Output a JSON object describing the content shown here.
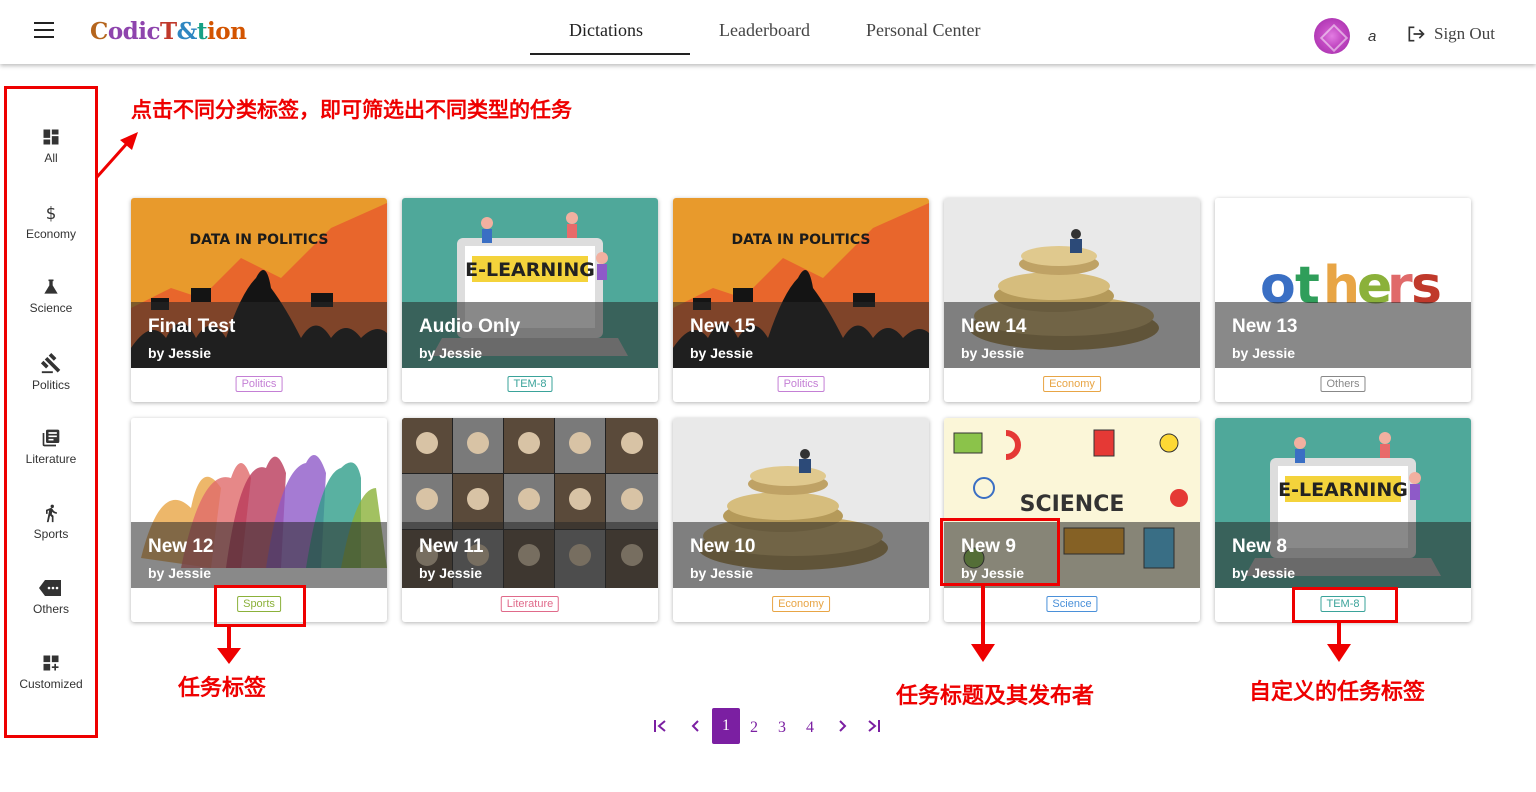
{
  "header": {
    "logo": {
      "c1": "C",
      "c2": "odic",
      "c3": "T",
      "c4": "&",
      "c5": "t",
      "c6": "ion"
    },
    "nav": [
      "Dictations",
      "Leaderboard",
      "Personal Center"
    ],
    "active_nav": "Dictations",
    "username": "a",
    "sign_out": "Sign Out"
  },
  "sidebar": {
    "items": [
      {
        "label": "All",
        "icon": "dashboard-icon"
      },
      {
        "label": "Economy",
        "icon": "dollar-icon"
      },
      {
        "label": "Science",
        "icon": "flask-icon"
      },
      {
        "label": "Politics",
        "icon": "gavel-icon"
      },
      {
        "label": "Literature",
        "icon": "library-books-icon"
      },
      {
        "label": "Sports",
        "icon": "run-icon"
      },
      {
        "label": "Others",
        "icon": "label-icon"
      },
      {
        "label": "Customized",
        "icon": "dashboard-add-icon"
      }
    ]
  },
  "annotations": {
    "filter_hint": "点击不同分类标签，即可筛选出不同类型的任务",
    "task_tag": "任务标签",
    "title_publisher": "任务标题及其发布者",
    "custom_tag": "自定义的任务标签"
  },
  "cards": [
    {
      "title": "Final Test",
      "author": "by Jessie",
      "tag": "Politics",
      "tag_color": "#c47fd5",
      "image": "data-in-politics",
      "image_text": "DATA IN POLITICS"
    },
    {
      "title": "Audio Only",
      "author": "by Jessie",
      "tag": "TEM-8",
      "tag_color": "#3aa39a",
      "image": "e-learning",
      "image_text": "E-LEARNING"
    },
    {
      "title": "New 15",
      "author": "by Jessie",
      "tag": "Politics",
      "tag_color": "#c47fd5",
      "image": "data-in-politics",
      "image_text": "DATA IN POLITICS"
    },
    {
      "title": "New 14",
      "author": "by Jessie",
      "tag": "Economy",
      "tag_color": "#e8a545",
      "image": "coins",
      "image_text": ""
    },
    {
      "title": "New 13",
      "author": "by Jessie",
      "tag": "Others",
      "tag_color": "#888888",
      "image": "others",
      "image_text": "others"
    },
    {
      "title": "New 12",
      "author": "by Jessie",
      "tag": "Sports",
      "tag_color": "#8bb13a",
      "image": "sports",
      "image_text": ""
    },
    {
      "title": "New 11",
      "author": "by Jessie",
      "tag": "Literature",
      "tag_color": "#e06a8a",
      "image": "portraits",
      "image_text": ""
    },
    {
      "title": "New 10",
      "author": "by Jessie",
      "tag": "Economy",
      "tag_color": "#e8a545",
      "image": "coins",
      "image_text": ""
    },
    {
      "title": "New 9",
      "author": "by Jessie",
      "tag": "Science",
      "tag_color": "#4a90d9",
      "image": "science",
      "image_text": "SCIENCE"
    },
    {
      "title": "New 8",
      "author": "by Jessie",
      "tag": "TEM-8",
      "tag_color": "#3aa39a",
      "image": "e-learning",
      "image_text": "E-LEARNING"
    }
  ],
  "pagination": {
    "first": "first-page-icon",
    "prev": "chevron-left-icon",
    "pages": [
      "1",
      "2",
      "3",
      "4"
    ],
    "current": "1",
    "next": "chevron-right-icon",
    "last": "last-page-icon"
  }
}
